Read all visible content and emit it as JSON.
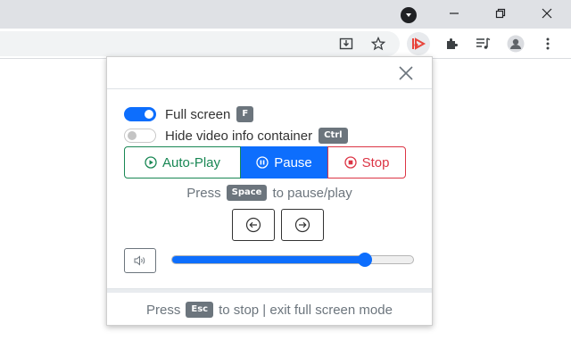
{
  "popup": {
    "fullscreen": {
      "label": "Full screen",
      "shortcut": "F",
      "enabled": true
    },
    "hide_info": {
      "label": "Hide video info container",
      "shortcut": "Ctrl",
      "enabled": false
    },
    "buttons": {
      "autoplay": "Auto-Play",
      "pause": "Pause",
      "stop": "Stop"
    },
    "space_hint": {
      "prefix": "Press",
      "key": "Space",
      "suffix": "to pause/play"
    },
    "volume": {
      "level": 0.8
    },
    "footer": {
      "prefix": "Press",
      "key": "Esc",
      "suffix": "to stop | exit full screen mode"
    }
  },
  "colors": {
    "primary": "#0d6efd",
    "success": "#198754",
    "danger": "#dc3545",
    "secondary": "#6c757d",
    "titlebar": "#dfe1e5"
  }
}
